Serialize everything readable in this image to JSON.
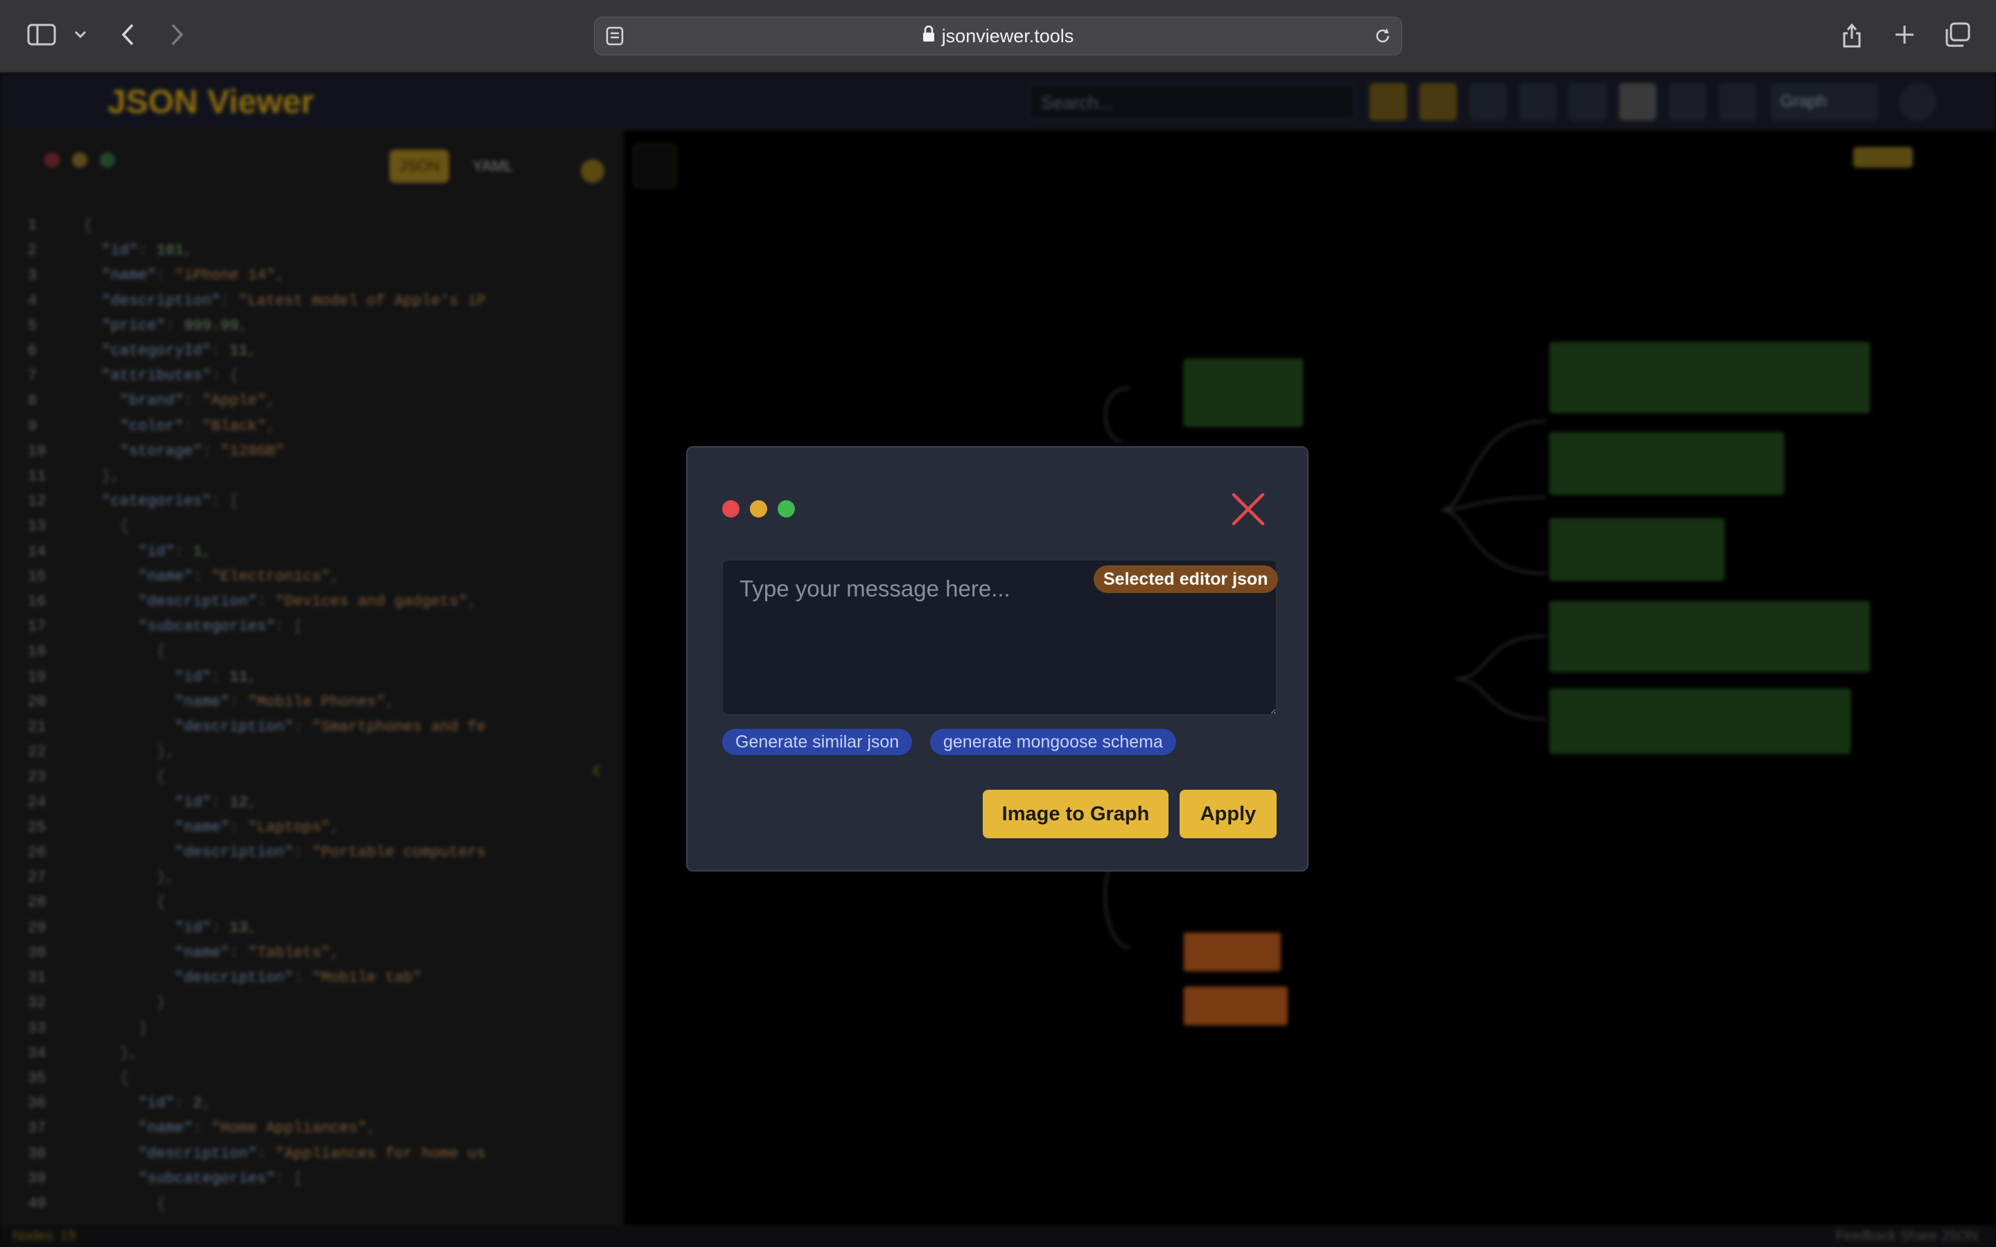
{
  "browser": {
    "url": "jsonviewer.tools",
    "icons": [
      "sidebar-toggle-icon",
      "chevron-down-icon",
      "back-icon",
      "forward-icon",
      "reader-icon",
      "lock-icon",
      "reload-icon",
      "share-icon",
      "new-tab-icon",
      "tab-overview-icon"
    ]
  },
  "app": {
    "logo": "JSON Viewer",
    "search_placeholder": "Search...",
    "view_select": "Graph",
    "editor_tabs": [
      "JSON",
      "YAML"
    ],
    "status_left": "Nodes: 19",
    "status_right": "Feedback  Share JSON"
  },
  "dialog": {
    "message_placeholder": "Type your message here...",
    "badge": "Selected editor json",
    "chips": [
      "Generate similar json",
      "generate mongoose schema"
    ],
    "image_to_graph_label": "Image to Graph",
    "apply_label": "Apply",
    "colors": {
      "accent": "#e6b83a",
      "close": "#e5484d",
      "chip": "#2a45a6"
    }
  }
}
